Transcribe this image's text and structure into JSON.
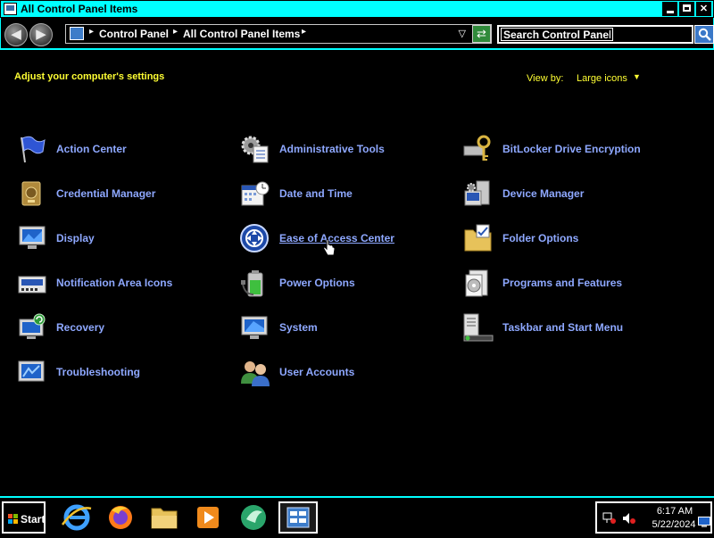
{
  "window": {
    "title": "All Control Panel Items"
  },
  "address": {
    "crumbs": [
      "Control Panel",
      "All Control Panel Items"
    ],
    "search_placeholder": "Search Control Panel"
  },
  "content": {
    "heading": "Adjust your computer's settings",
    "view_by_label": "View by:",
    "view_by_value": "Large icons",
    "items": [
      {
        "label": "Action Center",
        "icon": "action-center-flag-icon"
      },
      {
        "label": "Administrative Tools",
        "icon": "administrative-tools-icon"
      },
      {
        "label": "BitLocker Drive Encryption",
        "icon": "bitlocker-keys-icon"
      },
      {
        "label": "Credential Manager",
        "icon": "credential-vault-icon"
      },
      {
        "label": "Date and Time",
        "icon": "calendar-clock-icon"
      },
      {
        "label": "Device Manager",
        "icon": "device-manager-icon"
      },
      {
        "label": "Display",
        "icon": "monitor-icon"
      },
      {
        "label": "Ease of Access Center",
        "icon": "ease-of-access-icon"
      },
      {
        "label": "Folder Options",
        "icon": "folder-options-icon"
      },
      {
        "label": "Notification Area Icons",
        "icon": "notification-area-icon"
      },
      {
        "label": "Power Options",
        "icon": "battery-power-icon"
      },
      {
        "label": "Programs and Features",
        "icon": "programs-features-icon"
      },
      {
        "label": "Recovery",
        "icon": "recovery-icon"
      },
      {
        "label": "System",
        "icon": "system-computer-icon"
      },
      {
        "label": "Taskbar and Start Menu",
        "icon": "taskbar-start-menu-icon"
      },
      {
        "label": "Troubleshooting",
        "icon": "troubleshooting-icon"
      },
      {
        "label": "User Accounts",
        "icon": "user-accounts-icon"
      }
    ]
  },
  "taskbar": {
    "start_label": "Start",
    "apps": [
      "internet-explorer-icon",
      "firefox-icon",
      "file-explorer-icon",
      "media-player-icon",
      "media-center-icon",
      "control-panel-icon"
    ],
    "clock_time": "6:17 AM",
    "clock_date": "5/22/2024"
  },
  "colors": {
    "accent": "#00ffff",
    "link": "#8ea8ff",
    "heading": "#ffff33",
    "background": "#000000"
  }
}
